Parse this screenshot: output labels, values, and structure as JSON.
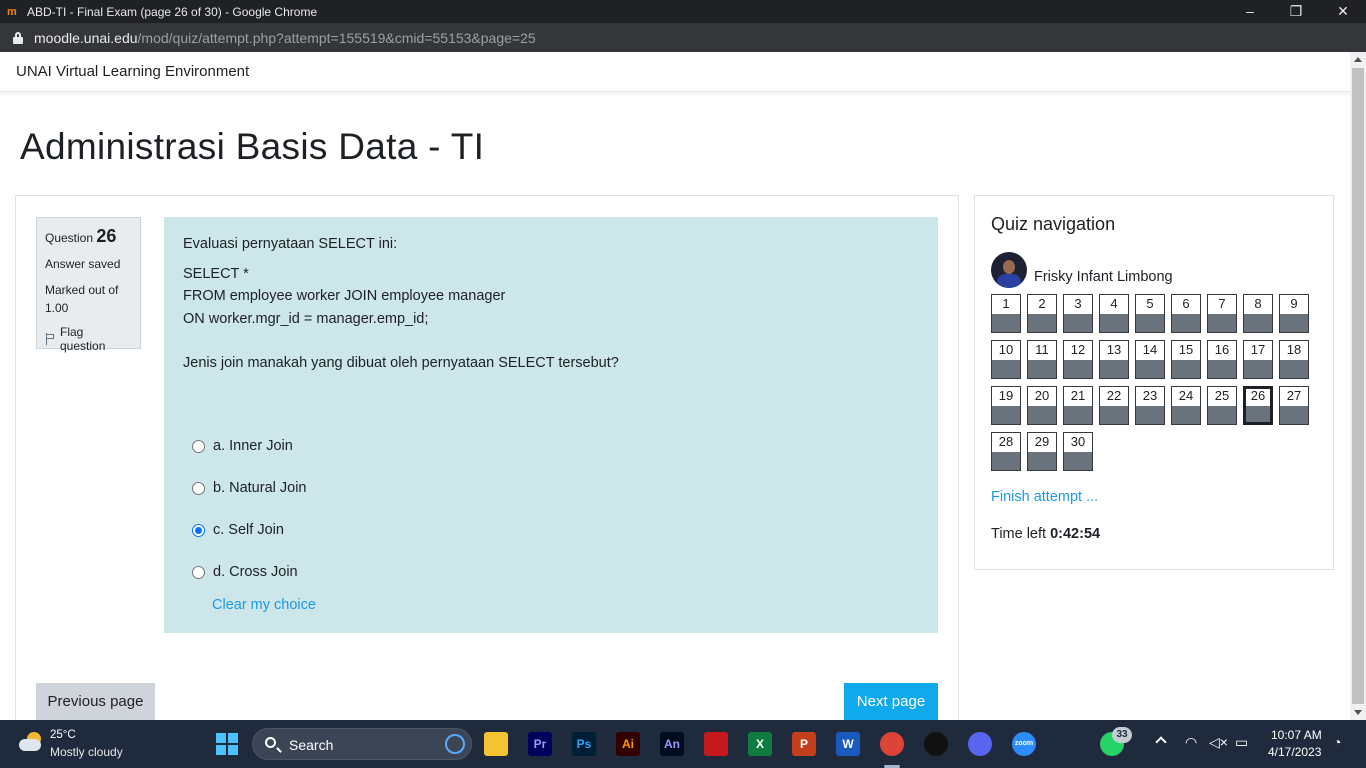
{
  "browser": {
    "tab_title": "ABD-TI - Final Exam (page 26 of 30) - Google Chrome",
    "url_host": "moodle.unai.edu",
    "url_path": "/mod/quiz/attempt.php?attempt=155519&cmid=55153&page=25",
    "minimize": "–",
    "maximize": "❐",
    "close": "✕"
  },
  "site": {
    "name": "UNAI Virtual Learning Environment"
  },
  "course": {
    "title": "Administrasi Basis Data - TI"
  },
  "question": {
    "label": "Question",
    "number": "26",
    "status": "Answer saved",
    "marked_out_of": "Marked out of 1.00",
    "flag_label": "Flag question",
    "text_intro": "Evaluasi pernyataan SELECT ini:",
    "sql_line1": "SELECT *",
    "sql_line2": "FROM employee worker JOIN employee manager",
    "sql_line3": "ON worker.mgr_id = manager.emp_id;",
    "prompt": "Jenis join manakah yang dibuat oleh pernyataan SELECT tersebut?",
    "answers": [
      {
        "label": "a. Inner Join",
        "selected": false
      },
      {
        "label": "b. Natural Join",
        "selected": false
      },
      {
        "label": "c. Self Join",
        "selected": true
      },
      {
        "label": "d. Cross Join",
        "selected": false
      }
    ],
    "clear_label": "Clear my choice"
  },
  "navigation": {
    "prev_label": "Previous page",
    "next_label": "Next page"
  },
  "quiz_nav": {
    "title": "Quiz navigation",
    "user_name": "Frisky Infant Limbong",
    "questions": [
      "1",
      "2",
      "3",
      "4",
      "5",
      "6",
      "7",
      "8",
      "9",
      "10",
      "11",
      "12",
      "13",
      "14",
      "15",
      "16",
      "17",
      "18",
      "19",
      "20",
      "21",
      "22",
      "23",
      "24",
      "25",
      "26",
      "27",
      "28",
      "29",
      "30"
    ],
    "current": "26",
    "finish_label": "Finish attempt ...",
    "time_left_label": "Time left",
    "time_left_value": "0:42:54"
  },
  "taskbar": {
    "weather_temp": "25°C",
    "weather_desc": "Mostly cloudy",
    "search_label": "Search",
    "apps": [
      {
        "name": "file-explorer-icon",
        "label": ""
      },
      {
        "name": "premiere-icon",
        "label": "Pr"
      },
      {
        "name": "photoshop-icon",
        "label": "Ps"
      },
      {
        "name": "illustrator-icon",
        "label": "Ai"
      },
      {
        "name": "animate-icon",
        "label": "An"
      },
      {
        "name": "acrobat-icon",
        "label": ""
      },
      {
        "name": "excel-icon",
        "label": "X"
      },
      {
        "name": "powerpoint-icon",
        "label": "P"
      },
      {
        "name": "word-icon",
        "label": "W"
      },
      {
        "name": "chrome-icon",
        "label": ""
      },
      {
        "name": "recorder-icon",
        "label": ""
      },
      {
        "name": "discord-icon",
        "label": ""
      },
      {
        "name": "zoom-icon",
        "label": "zoom"
      },
      {
        "name": "vscode-icon",
        "label": ""
      },
      {
        "name": "whatsapp-icon",
        "label": ""
      }
    ],
    "whatsapp_badge": "33",
    "clock_time": "10:07 AM",
    "clock_date": "4/17/2023"
  },
  "colors": {
    "accent": "#0fa9ec",
    "link": "#1a9ae2",
    "question_bg": "#cce6ea",
    "info_bg": "#e9ecef",
    "taskbar_bg": "#1f2a3c"
  }
}
